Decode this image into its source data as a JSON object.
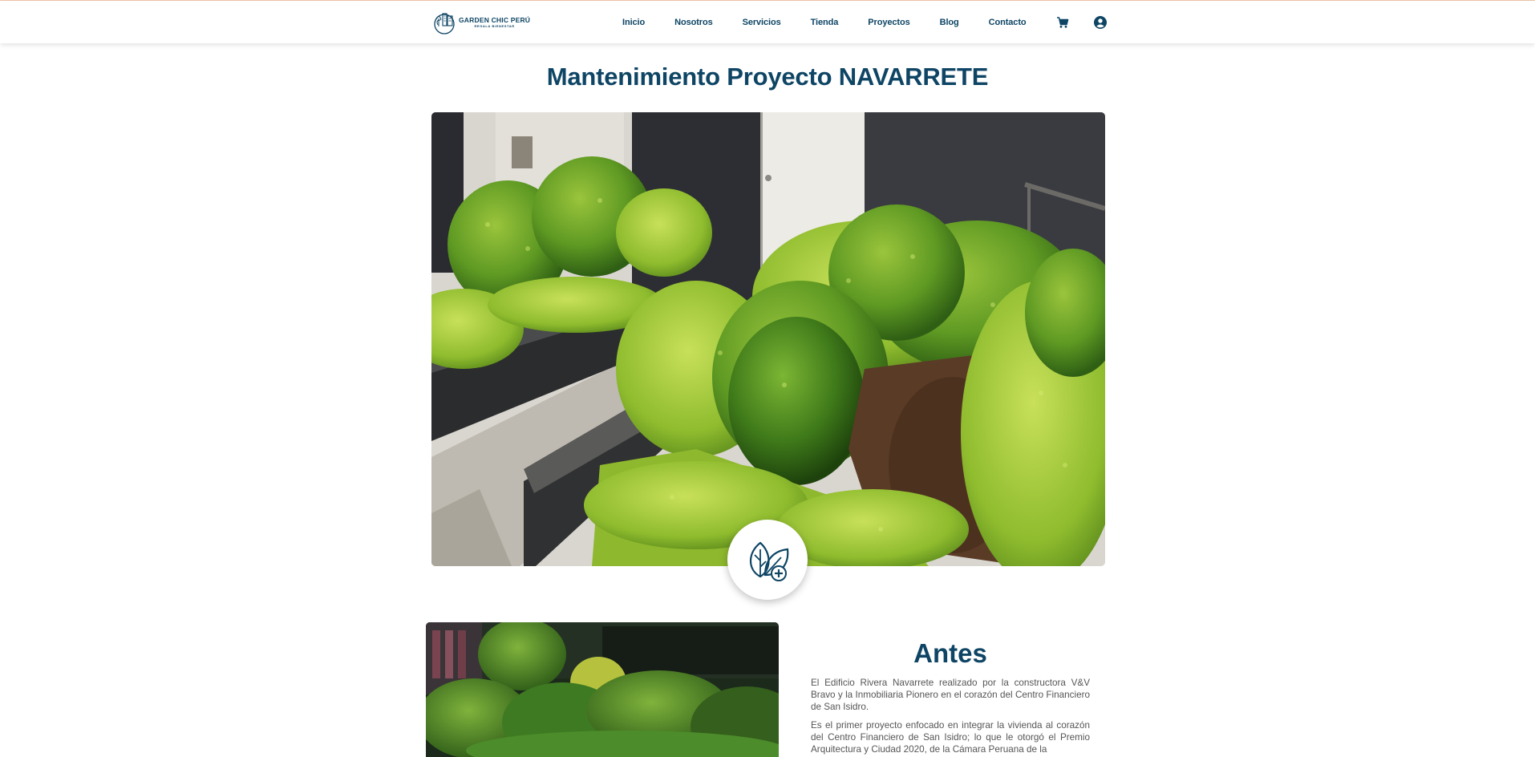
{
  "brand": {
    "name": "GARDEN CHIC PERÚ",
    "tagline": "REGALA BIENESTAR"
  },
  "nav": {
    "items": [
      "Inicio",
      "Nosotros",
      "Servicios",
      "Tienda",
      "Proyectos",
      "Blog",
      "Contacto"
    ]
  },
  "icons": {
    "cart": "cart-icon",
    "account": "account-icon",
    "badge": "leaf-plus-icon"
  },
  "colors": {
    "primary": "#0e4565",
    "text": "#555555",
    "accent_line": "#f1c7a8"
  },
  "page": {
    "title": "Mantenimiento Proyecto NAVARRETE"
  },
  "before": {
    "heading": "Antes",
    "paragraphs": [
      "El Edificio Rivera Navarrete realizado por la constructora V&V Bravo y la Inmobiliaria Pionero en el corazón del Centro Financiero de San Isidro.",
      "Es el primer proyecto enfocado en integrar la vivienda al corazón del Centro Financiero de San Isidro; lo que le otorgó el Premio Arquitectura y Ciudad 2020, de la Cámara Peruana de la"
    ]
  }
}
